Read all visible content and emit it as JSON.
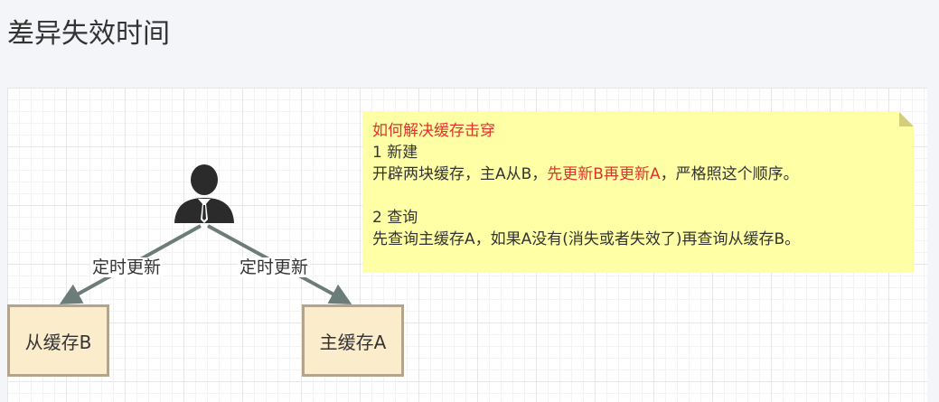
{
  "page": {
    "title": "差异失效时间"
  },
  "diagram": {
    "edge_left_label": "定时更新",
    "edge_right_label": "定时更新",
    "box_left_label": "从缓存B",
    "box_right_label": "主缓存A"
  },
  "note": {
    "heading": "如何解决缓存击穿",
    "section1_title": "1 新建",
    "section1_text_a": "开辟两块缓存，主A从B，",
    "section1_text_highlight": "先更新B再更新A",
    "section1_text_b": "，严格照这个顺序。",
    "section2_title": "2 查询",
    "section2_text": "先查询主缓存A，如果A没有(消失或者失效了)再查询从缓存B。"
  },
  "colors": {
    "highlight": "#e0322e",
    "note_bg": "#ffffa6",
    "box_bg": "#fbeccb",
    "box_border": "#b2a58b",
    "arrow": "#6b7c79"
  }
}
